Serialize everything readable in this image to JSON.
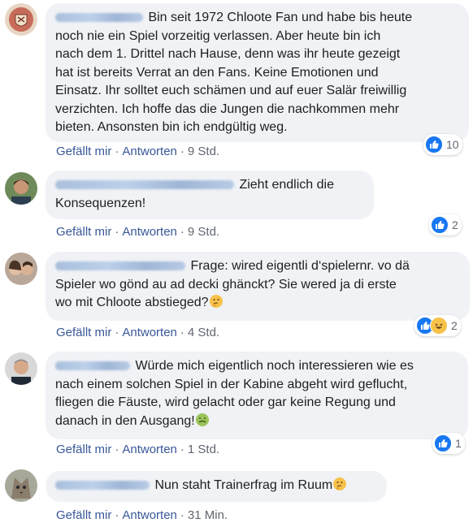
{
  "comments": [
    {
      "lines": [
        "Bin seit 1972 Chloote Fan und habe bis heute",
        "noch nie ein Spiel vorzeitig verlassen. Aber heute bin ich",
        "nach dem 1. Drittel nach Hause, denn was ihr heute gezeigt",
        "hat ist bereits Verrat an den Fans. Keine Emotionen und",
        "Einsatz. Ihr solltet euch schämen und auf euer Salär freiwillig",
        "verzichten. Ich hoffe das die Jungen die nachkommen mehr",
        "bieten. Ansonsten bin ich endgültig weg."
      ],
      "like_label": "Gefällt mir",
      "reply_label": "Antworten",
      "time": "9 Std.",
      "reaction_count": "10"
    },
    {
      "lines": [
        "Zieht endlich die",
        "Konsequenzen!"
      ],
      "like_label": "Gefällt mir",
      "reply_label": "Antworten",
      "time": "9 Std.",
      "reaction_count": "2"
    },
    {
      "lines": [
        "Frage: wired eigentli d‘spielernr. vo dä",
        "Spieler wo gönd au ad decki ghänckt? Sie wered ja di erste",
        "wo mit Chloote abstieged?"
      ],
      "like_label": "Gefällt mir",
      "reply_label": "Antworten",
      "time": "4 Std.",
      "reaction_count": "2"
    },
    {
      "lines": [
        "Würde mich eigentlich noch interessieren wie es",
        "nach einem solchen Spiel in der Kabine abgeht wird geflucht,",
        "fliegen die Fäuste, wird gelacht oder gar keine Regung und",
        "danach in den Ausgang!"
      ],
      "like_label": "Gefällt mir",
      "reply_label": "Antworten",
      "time": "1 Std.",
      "reaction_count": "1"
    },
    {
      "lines": [
        "Nun staht Trainerfrag im Ruum"
      ],
      "like_label": "Gefällt mir",
      "reply_label": "Antworten",
      "time": "31 Min."
    }
  ],
  "separator": "·",
  "colors": {
    "like_blue": "#1877f2",
    "link": "#385898",
    "bubble_bg": "#f0f2f5",
    "meta_gray": "#606770"
  }
}
